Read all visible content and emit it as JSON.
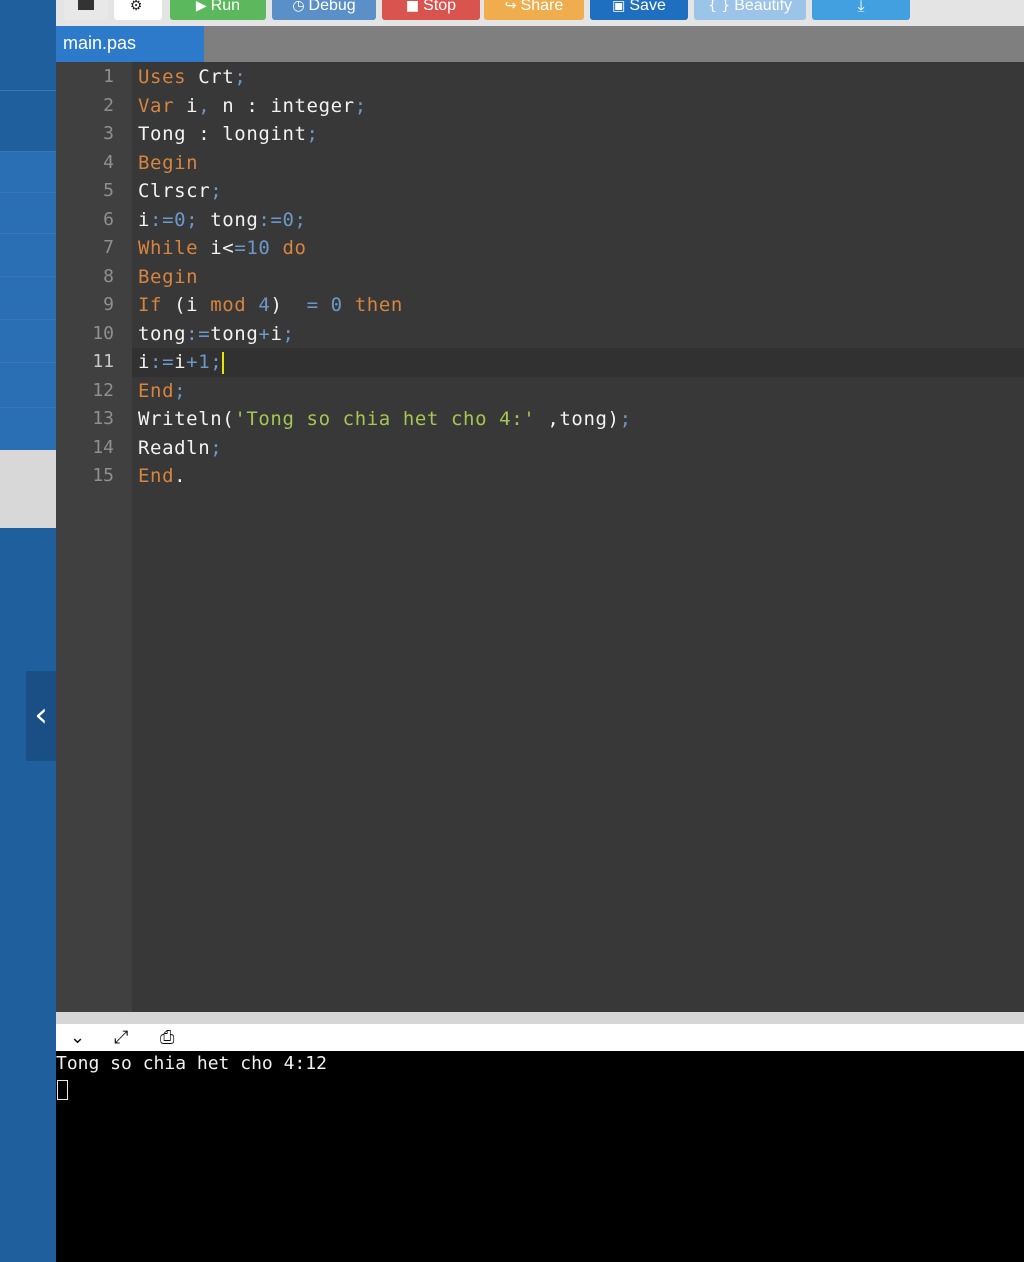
{
  "toolbar": {
    "buttons": [
      {
        "label": "",
        "icon": "dark-square-icon",
        "color": "#e8e8e8"
      },
      {
        "label": "",
        "icon": "upload-settings-icon",
        "color": "#ffffff"
      },
      {
        "label": "Run",
        "icon": "play-icon",
        "color": "#5cb85c"
      },
      {
        "label": "Debug",
        "icon": "debug-icon",
        "color": "#5b8fc7"
      },
      {
        "label": "Stop",
        "icon": "stop-icon",
        "color": "#d9534f"
      },
      {
        "label": "Share",
        "icon": "share-icon",
        "color": "#f0ad4e"
      },
      {
        "label": "Save",
        "icon": "save-icon",
        "color": "#1f6fc0"
      },
      {
        "label": "Beautify",
        "icon": "braces-icon",
        "color": "#9cc3e8"
      },
      {
        "label": "",
        "icon": "download-icon",
        "color": "#43a0e0"
      }
    ]
  },
  "tabs": {
    "file_tab": "main.pas"
  },
  "editor": {
    "line_numbers": [
      "1",
      "2",
      "3",
      "4",
      "5",
      "6",
      "7",
      "8",
      "9",
      "10",
      "11",
      "12",
      "13",
      "14",
      "15"
    ],
    "active_line": 11,
    "lines": [
      [
        {
          "t": "Uses",
          "c": "kw"
        },
        {
          "t": " Crt",
          "c": ""
        },
        {
          "t": ";",
          "c": "op"
        }
      ],
      [
        {
          "t": "Var",
          "c": "kw"
        },
        {
          "t": " i",
          "c": ""
        },
        {
          "t": ",",
          "c": "op"
        },
        {
          "t": " n : integer",
          "c": ""
        },
        {
          "t": ";",
          "c": "op"
        }
      ],
      [
        {
          "t": "Tong : longint",
          "c": ""
        },
        {
          "t": ";",
          "c": "op"
        }
      ],
      [
        {
          "t": "Begin",
          "c": "kw"
        }
      ],
      [
        {
          "t": "Clrscr",
          "c": ""
        },
        {
          "t": ";",
          "c": "op"
        }
      ],
      [
        {
          "t": "i",
          "c": ""
        },
        {
          "t": ":=0;",
          "c": "op"
        },
        {
          "t": " tong",
          "c": ""
        },
        {
          "t": ":=0;",
          "c": "op"
        }
      ],
      [
        {
          "t": "While",
          "c": "kw"
        },
        {
          "t": " i<",
          "c": ""
        },
        {
          "t": "=10",
          "c": "op"
        },
        {
          "t": " do",
          "c": "kw"
        }
      ],
      [
        {
          "t": "Begin",
          "c": "kw"
        }
      ],
      [
        {
          "t": "If",
          "c": "kw"
        },
        {
          "t": " (i ",
          "c": ""
        },
        {
          "t": "mod",
          "c": "kw"
        },
        {
          "t": " ",
          "c": ""
        },
        {
          "t": "4",
          "c": "num"
        },
        {
          "t": ")  ",
          "c": ""
        },
        {
          "t": "= 0",
          "c": "op"
        },
        {
          "t": " then",
          "c": "kw"
        }
      ],
      [
        {
          "t": "tong",
          "c": ""
        },
        {
          "t": ":=",
          "c": "op"
        },
        {
          "t": "tong",
          "c": ""
        },
        {
          "t": "+",
          "c": "op"
        },
        {
          "t": "i",
          "c": ""
        },
        {
          "t": ";",
          "c": "op"
        }
      ],
      [
        {
          "t": "i",
          "c": ""
        },
        {
          "t": ":=",
          "c": "op"
        },
        {
          "t": "i",
          "c": ""
        },
        {
          "t": "+1;",
          "c": "op"
        }
      ],
      [
        {
          "t": "End",
          "c": "kw"
        },
        {
          "t": ";",
          "c": "op"
        }
      ],
      [
        {
          "t": "Writeln(",
          "c": ""
        },
        {
          "t": "'Tong so chia het cho 4:'",
          "c": "str"
        },
        {
          "t": " ,tong)",
          "c": ""
        },
        {
          "t": ";",
          "c": "op"
        }
      ],
      [
        {
          "t": "Readln",
          "c": ""
        },
        {
          "t": ";",
          "c": "op"
        }
      ],
      [
        {
          "t": "End",
          "c": "kw"
        },
        {
          "t": ".",
          "c": ""
        }
      ]
    ]
  },
  "console": {
    "icons": [
      "chevron-down-icon",
      "expand-icon",
      "clear-console-icon"
    ],
    "output": "Tong so chia het cho 4:12"
  },
  "sidebar": {
    "collapse_icon": "chevron-left-icon"
  }
}
